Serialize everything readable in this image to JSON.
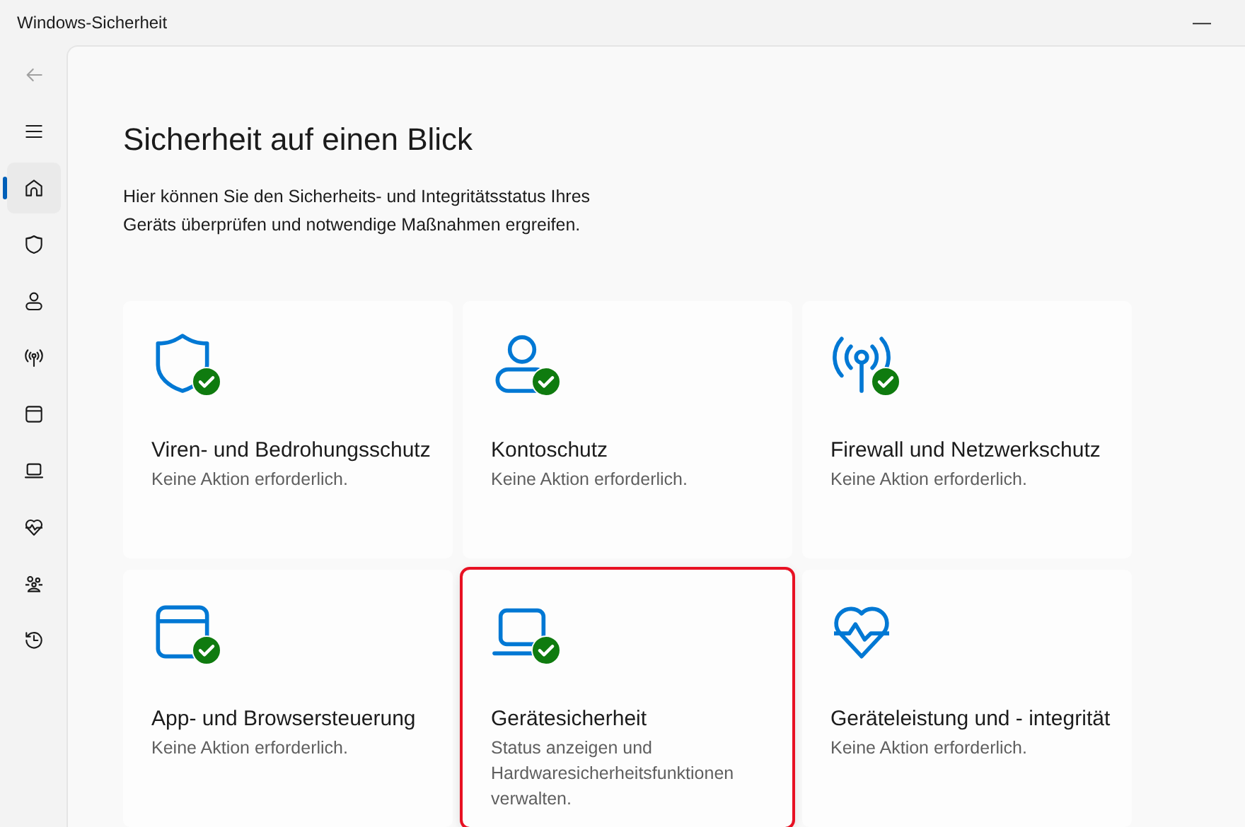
{
  "window": {
    "title": "Windows-Sicherheit",
    "minimize": "—"
  },
  "sidebar": {
    "items": [
      {
        "kind": "back",
        "selected": false,
        "disabled": true
      },
      {
        "kind": "menu",
        "selected": false,
        "disabled": false
      },
      {
        "kind": "home",
        "selected": true,
        "disabled": false
      },
      {
        "kind": "shield",
        "selected": false,
        "disabled": false
      },
      {
        "kind": "person",
        "selected": false,
        "disabled": false
      },
      {
        "kind": "antenna",
        "selected": false,
        "disabled": false
      },
      {
        "kind": "browser",
        "selected": false,
        "disabled": false
      },
      {
        "kind": "laptop",
        "selected": false,
        "disabled": false
      },
      {
        "kind": "heart",
        "selected": false,
        "disabled": false
      },
      {
        "kind": "family",
        "selected": false,
        "disabled": false
      },
      {
        "kind": "history",
        "selected": false,
        "disabled": false
      }
    ]
  },
  "page": {
    "title": "Sicherheit auf einen Blick",
    "description": "Hier können Sie den Sicherheits- und Integritätsstatus Ihres Geräts überprüfen und notwendige Maßnahmen ergreifen."
  },
  "cards": [
    {
      "kind": "shield",
      "title": "Viren- und Bedrohungsschutz",
      "status": "Keine Aktion erforderlich.",
      "ok": true,
      "highlighted": false
    },
    {
      "kind": "person",
      "title": "Kontoschutz",
      "status": "Keine Aktion erforderlich.",
      "ok": true,
      "highlighted": false
    },
    {
      "kind": "antenna",
      "title": "Firewall und Netzwerkschutz",
      "status": "Keine Aktion erforderlich.",
      "ok": true,
      "highlighted": false
    },
    {
      "kind": "browser",
      "title": "App- und Browsersteuerung",
      "status": "Keine Aktion erforderlich.",
      "ok": true,
      "highlighted": false
    },
    {
      "kind": "laptop",
      "title": "Gerätesicherheit",
      "status": "Status anzeigen und Hardwaresicherheitsfunktionen verwalten.",
      "ok": true,
      "highlighted": true
    },
    {
      "kind": "heart",
      "title": "Geräteleistung und - integrität",
      "status": "Keine Aktion erforderlich.",
      "ok": false,
      "highlighted": false
    }
  ]
}
